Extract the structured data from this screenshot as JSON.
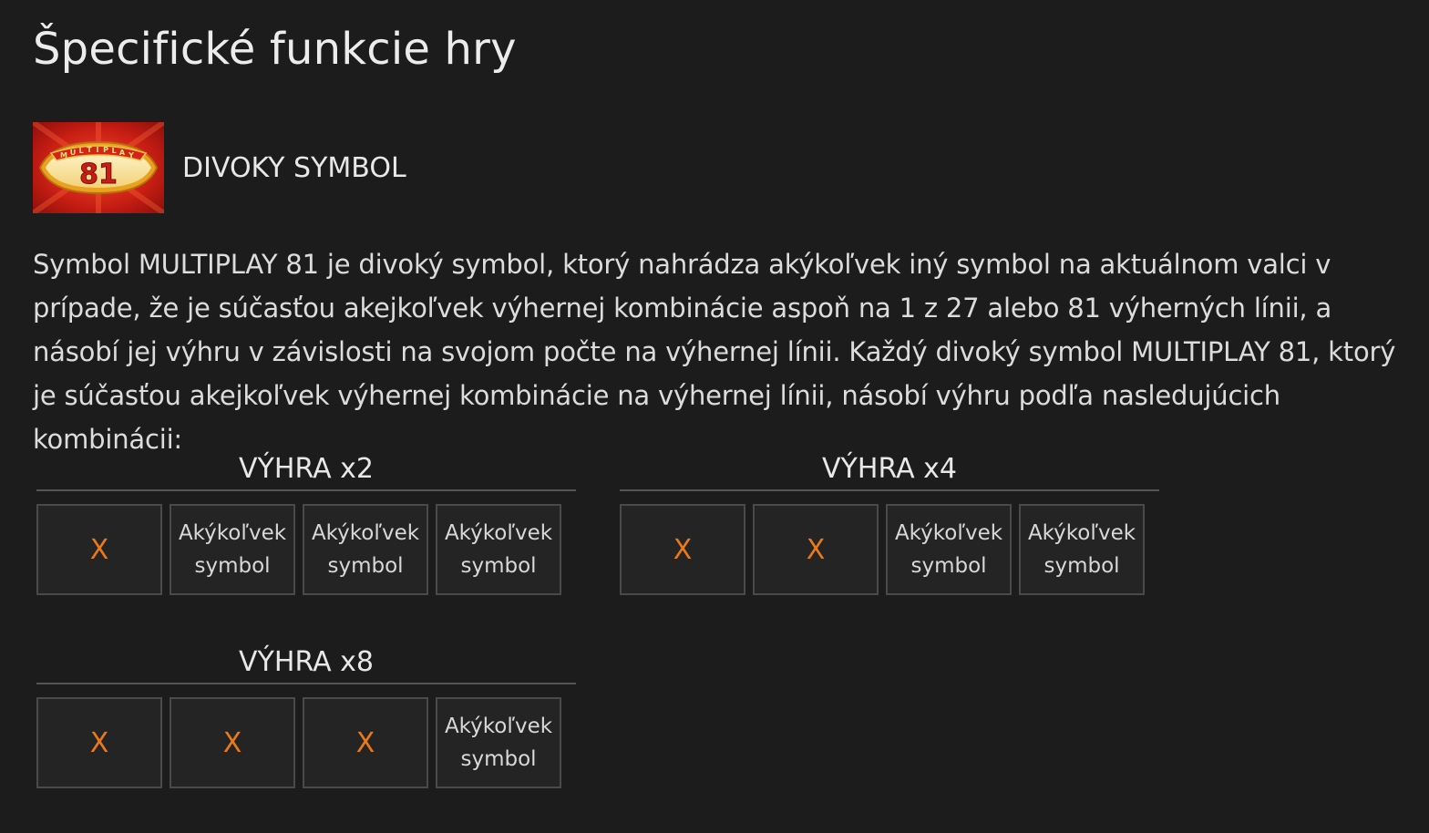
{
  "page": {
    "title": "Špecifické funkcie hry"
  },
  "feature": {
    "logo_icon": "multiplay-81-logo-icon",
    "logo_text_top": "MULTIPLAY",
    "logo_text_number": "81",
    "name": "DIVOKY SYMBOL",
    "description": "Symbol MULTIPLAY 81 je divoký symbol, ktorý nahrádza akýkoľvek iný symbol na aktuálnom valci v prípade, že je súčasťou akejkoľvek výhernej kombinácie aspoň na 1 z 27 alebo 81 výherných línii, a násobí jej výhru v závislosti na svojom počte na výhernej línii. Každý divoký symbol MULTIPLAY 81, ktorý je súčasťou akejkoľvek výhernej kombinácie na výhernej línii, násobí výhru podľa nasledujúcich kombinácii:"
  },
  "combos": [
    {
      "title": "VÝHRA x2",
      "cells": [
        "X",
        "Akýkoľvek\nsymbol",
        "Akýkoľvek\nsymbol",
        "Akýkoľvek\nsymbol"
      ]
    },
    {
      "title": "VÝHRA x4",
      "cells": [
        "X",
        "X",
        "Akýkoľvek\nsymbol",
        "Akýkoľvek\nsymbol"
      ]
    },
    {
      "title": "VÝHRA x8",
      "cells": [
        "X",
        "X",
        "X",
        "Akýkoľvek\nsymbol"
      ]
    }
  ],
  "colors": {
    "background": "#1c1c1c",
    "accent_x": "#e87a1a",
    "cell_border": "#4a4a4a"
  }
}
